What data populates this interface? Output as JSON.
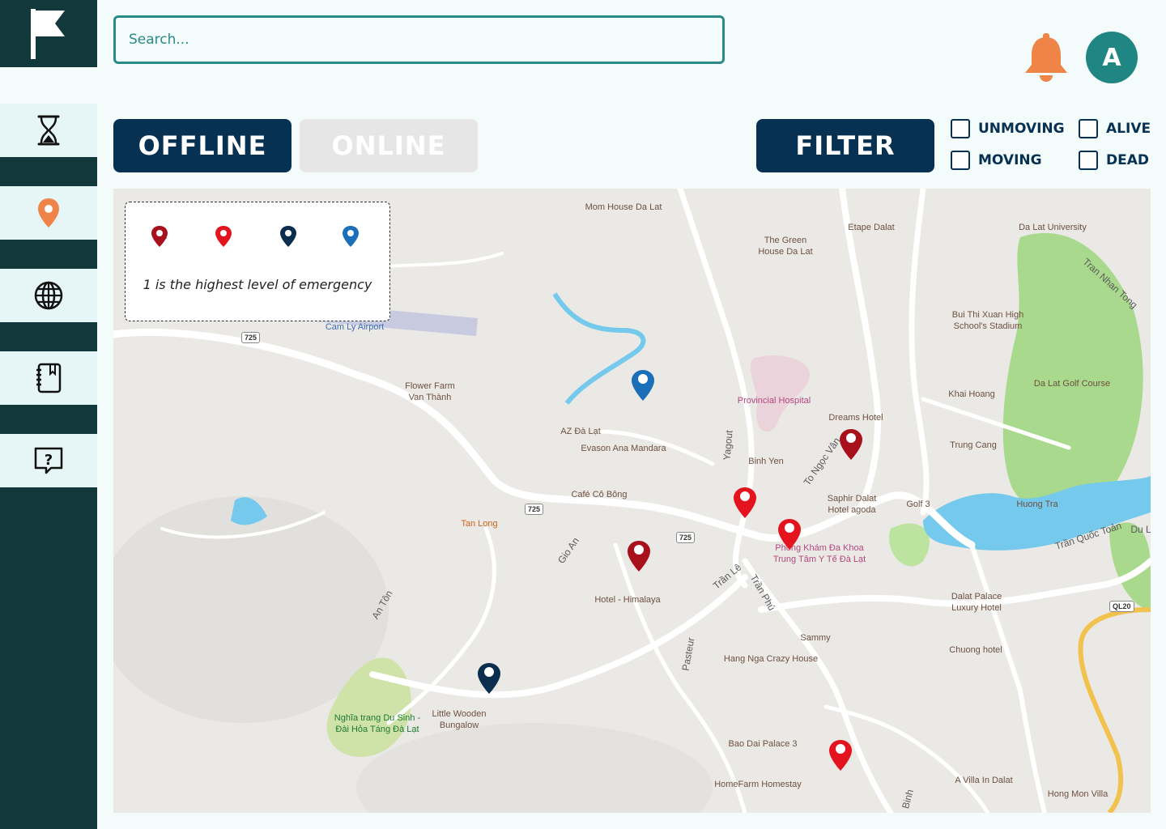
{
  "app": {
    "logo_icon": "flag-icon"
  },
  "sidebar": {
    "items": [
      {
        "name": "hourglass",
        "icon": "hourglass-icon"
      },
      {
        "name": "map",
        "icon": "map-pin-icon",
        "active": true
      },
      {
        "name": "globe",
        "icon": "globe-icon"
      },
      {
        "name": "notebook",
        "icon": "notebook-icon"
      },
      {
        "name": "help",
        "icon": "help-icon"
      }
    ]
  },
  "header": {
    "search": {
      "placeholder": "Search...",
      "value": ""
    },
    "notifications_icon": "bell-icon",
    "avatar": {
      "initial": "A"
    }
  },
  "toolbar": {
    "offline_label": "OFFLINE",
    "online_label": "ONLINE",
    "filter_label": "FILTER",
    "checkboxes": {
      "unmoving": {
        "label": "UNMOVING",
        "checked": false
      },
      "moving": {
        "label": "MOVING",
        "checked": false
      },
      "alive": {
        "label": "ALIVE",
        "checked": false
      },
      "dead": {
        "label": "DEAD",
        "checked": false
      }
    }
  },
  "legend": {
    "levels": [
      {
        "num": "1",
        "color": "#a8101b"
      },
      {
        "num": "2",
        "color": "#e3141e"
      },
      {
        "num": "3",
        "color": "#0b2e4e"
      },
      {
        "num": "4",
        "color": "#1a6fb8"
      }
    ],
    "note": "1 is the highest level of emergency"
  },
  "map": {
    "places": {
      "mom_house": "Mom House Da Lat",
      "green_house": "The Green\nHouse Da Lat",
      "etape": "Etape Dalat",
      "dalat_university": "Da Lat University",
      "cam_ly_airport": "Cam Ly Airport",
      "bui_thi_xuan": "Bui Thi Xuan High\nSchool's Stadium",
      "flower_farm": "Flower Farm\nVan Thành",
      "provincial_hospital": "Provincial Hospital",
      "golf_course": "Da Lat Golf Course",
      "khai_hoang": "Khai Hoang",
      "az_dalat": "AZ Đà Lạt",
      "dreams_hotel": "Dreams Hotel",
      "evason": "Evason Ana Mandara",
      "binh_yen": "Binh Yen",
      "trung_cang": "Trung Cang",
      "cafe_co_bong": "Café Cô Bông",
      "saphir": "Saphir Dalat\nHotel agoda",
      "golf3": "Golf 3",
      "huong_tra": "Huong Tra",
      "tan_long": "Tan Long",
      "phong_kham": "Phòng Khám Đa Khoa\nTrung Tâm Y Tế Đà Lạt",
      "hotel_himalaya": "Hotel - Himalaya",
      "dalat_palace": "Dalat Palace\nLuxury Hotel",
      "sammy": "Sammy",
      "chuong_hotel": "Chuong hotel",
      "hang_nga": "Hang Nga Crazy House",
      "little_wooden": "Little Wooden\nBungalow",
      "nghia_trang": "Nghĩa trang Du Sinh -\nĐài Hỏa Táng Đà Lạt",
      "bao_dai": "Bao Dai Palace 3",
      "homefarm": "HomeFarm Homestay",
      "villa": "A Villa In Dalat",
      "hong_mon": "Hong Mon Villa"
    },
    "streets": {
      "tran_nhan_tong": "Tran Nhan Tong",
      "to_ngoc_van": "To Ngọc Vân",
      "yagout": "Yagout",
      "gio_an": "Gio An",
      "an_ton": "An Tôn",
      "tran_le": "Trần Lê",
      "tran_phu": "Trần Phú",
      "pasteur": "Pasteur",
      "tran_quoc_toan": "Trần Quốc Toản",
      "binh": "Binh",
      "du_l": "Du L"
    },
    "road_shields": {
      "r725": "725",
      "ql20": "QL20"
    },
    "markers": [
      {
        "level": 4,
        "color": "#1a6fb8"
      },
      {
        "level": 1,
        "color": "#a8101b"
      },
      {
        "level": 2,
        "color": "#e3141e"
      },
      {
        "level": 2,
        "color": "#e3141e"
      },
      {
        "level": 1,
        "color": "#a8101b"
      },
      {
        "level": 3,
        "color": "#0b2e4e"
      },
      {
        "level": 2,
        "color": "#e3141e"
      }
    ]
  }
}
